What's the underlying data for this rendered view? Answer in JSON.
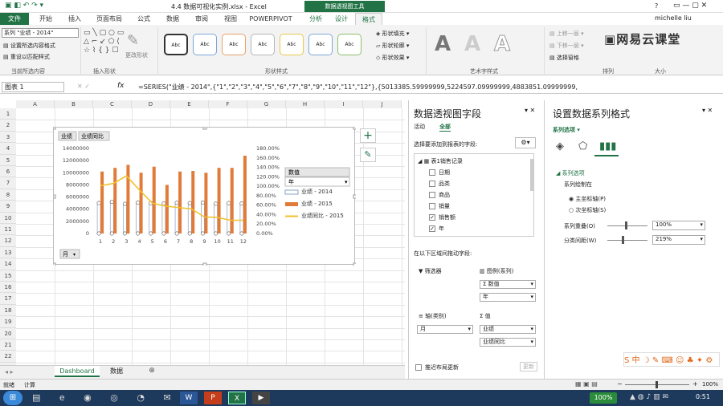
{
  "window": {
    "title": "4.4 数据可视化实例.xlsx - Excel",
    "context_tools": "数据透视图工具",
    "user": "michelle liu",
    "help": "?"
  },
  "ribbon": {
    "tabs": [
      "文件",
      "开始",
      "插入",
      "页面布局",
      "公式",
      "数据",
      "审阅",
      "视图",
      "POWERPIVOT",
      "分析",
      "设计",
      "格式"
    ],
    "selection_box": "系列 \"业绩 - 2014\"",
    "btn_format_selection": "设置所选内容格式",
    "btn_reset_match": "重设以匹配样式",
    "group_current_selection": "当前所选内容",
    "group_insert_shapes": "插入形状",
    "btn_change_shape": "更改形状",
    "group_shape_styles": "形状样式",
    "shape_style_label": "Abc",
    "btn_shape_fill": "形状填充",
    "btn_shape_outline": "形状轮廓",
    "btn_shape_effects": "形状效果",
    "wordart_letter": "A",
    "group_wordart": "艺术字样式",
    "btn_bring_forward": "上移一层",
    "btn_send_backward": "下移一层",
    "btn_selection_pane": "选择窗格",
    "group_arrange": "排列",
    "group_size": "大小",
    "watermark": "网易云课堂"
  },
  "formula": {
    "namebox": "图表 1",
    "fx": "fx",
    "content": "=SERIES(\"业绩 - 2014\",{\"1\",\"2\",\"3\",\"4\",\"5\",\"6\",\"7\",\"8\",\"9\",\"10\",\"11\",\"12\"},{5013385.59999999,5224597.09999999,4883851.09999999,"
  },
  "grid": {
    "columns": [
      "A",
      "B",
      "C",
      "D",
      "E",
      "F",
      "G",
      "H",
      "I",
      "J"
    ],
    "rows": [
      "1",
      "2",
      "3",
      "4",
      "5",
      "6",
      "7",
      "8",
      "9",
      "10",
      "11",
      "12",
      "13",
      "14",
      "15",
      "16",
      "17",
      "18",
      "19",
      "20",
      "21",
      "22",
      "23"
    ]
  },
  "chart_data": {
    "type": "bar",
    "field_buttons": [
      "业绩",
      "业绩同比"
    ],
    "axis_button": "月",
    "categories": [
      "1",
      "2",
      "3",
      "4",
      "5",
      "6",
      "7",
      "8",
      "9",
      "10",
      "11",
      "12"
    ],
    "ylim": [
      0,
      14000000
    ],
    "yticks": [
      "0",
      "2000000",
      "4000000",
      "6000000",
      "8000000",
      "10000000",
      "12000000",
      "14000000"
    ],
    "y2lim": [
      0,
      1.8
    ],
    "y2ticks": [
      "0.00%",
      "20.00%",
      "40.00%",
      "60.00%",
      "80.00%",
      "100.00%",
      "120.00%",
      "140.00%",
      "160.00%",
      "180.00%"
    ],
    "legend_title": "数值",
    "legend_dropdown": "年",
    "series": [
      {
        "name": "业绩 - 2014",
        "kind": "bar",
        "color": "#4a6fa5",
        "values": [
          5013385.6,
          5224597.1,
          4883851.1,
          5100000,
          5000000,
          4950000,
          5050000,
          5000000,
          5100000,
          4900000,
          5000000,
          4950000
        ]
      },
      {
        "name": "业绩 - 2015",
        "kind": "bar",
        "color": "#e07b39",
        "values": [
          10200000,
          10800000,
          11300000,
          10000000,
          11000000,
          8000000,
          10200000,
          10300000,
          10000000,
          10800000,
          10800000,
          12800000
        ]
      },
      {
        "name": "业绩同比 - 2015",
        "kind": "line",
        "axis": "secondary",
        "color": "#f2c12e",
        "values": [
          1.01,
          1.06,
          1.22,
          0.92,
          0.64,
          0.58,
          0.55,
          0.52,
          0.35,
          0.34,
          0.28,
          0.28
        ]
      }
    ]
  },
  "sheets": {
    "tabs": [
      "Dashboard",
      "数据"
    ],
    "active": "Dashboard",
    "add": "⊕"
  },
  "pivot": {
    "title": "数据透视图字段",
    "tab_active": "活动",
    "tab_all": "全部",
    "choose_label": "选择要添加到报表的字段:",
    "table_name": "表1销售记录",
    "fields": [
      {
        "label": "日期",
        "checked": false
      },
      {
        "label": "品类",
        "checked": false
      },
      {
        "label": "商品",
        "checked": false
      },
      {
        "label": "销量",
        "checked": false
      },
      {
        "label": "销售额",
        "checked": true
      },
      {
        "label": "年",
        "checked": true
      }
    ],
    "drag_label": "在以下区域间拖动字段:",
    "filter_label": "筛选器",
    "legend_label": "图例(系列)",
    "legend_items": [
      "Σ 数值",
      "年"
    ],
    "axis_label": "轴(类别)",
    "axis_items": [
      "月"
    ],
    "values_label": "值",
    "values_items": [
      "业绩",
      "业绩同比"
    ],
    "defer_label": "推迟布局更新",
    "update_btn": "更新"
  },
  "format_pane": {
    "title": "设置数据系列格式",
    "options_label": "系列选项",
    "section": "系列选项",
    "plot_on": "系列绘制在",
    "primary": "主坐标轴(P)",
    "secondary": "次坐标轴(S)",
    "overlap_label": "系列重叠(O)",
    "overlap_value": "100%",
    "gap_label": "分类间距(W)",
    "gap_value": "219%"
  },
  "status": {
    "ready": "就绪",
    "calc": "计算",
    "zoom": "100%"
  },
  "taskbar": {
    "zoom_badge": "100%",
    "clock": "0:51"
  }
}
